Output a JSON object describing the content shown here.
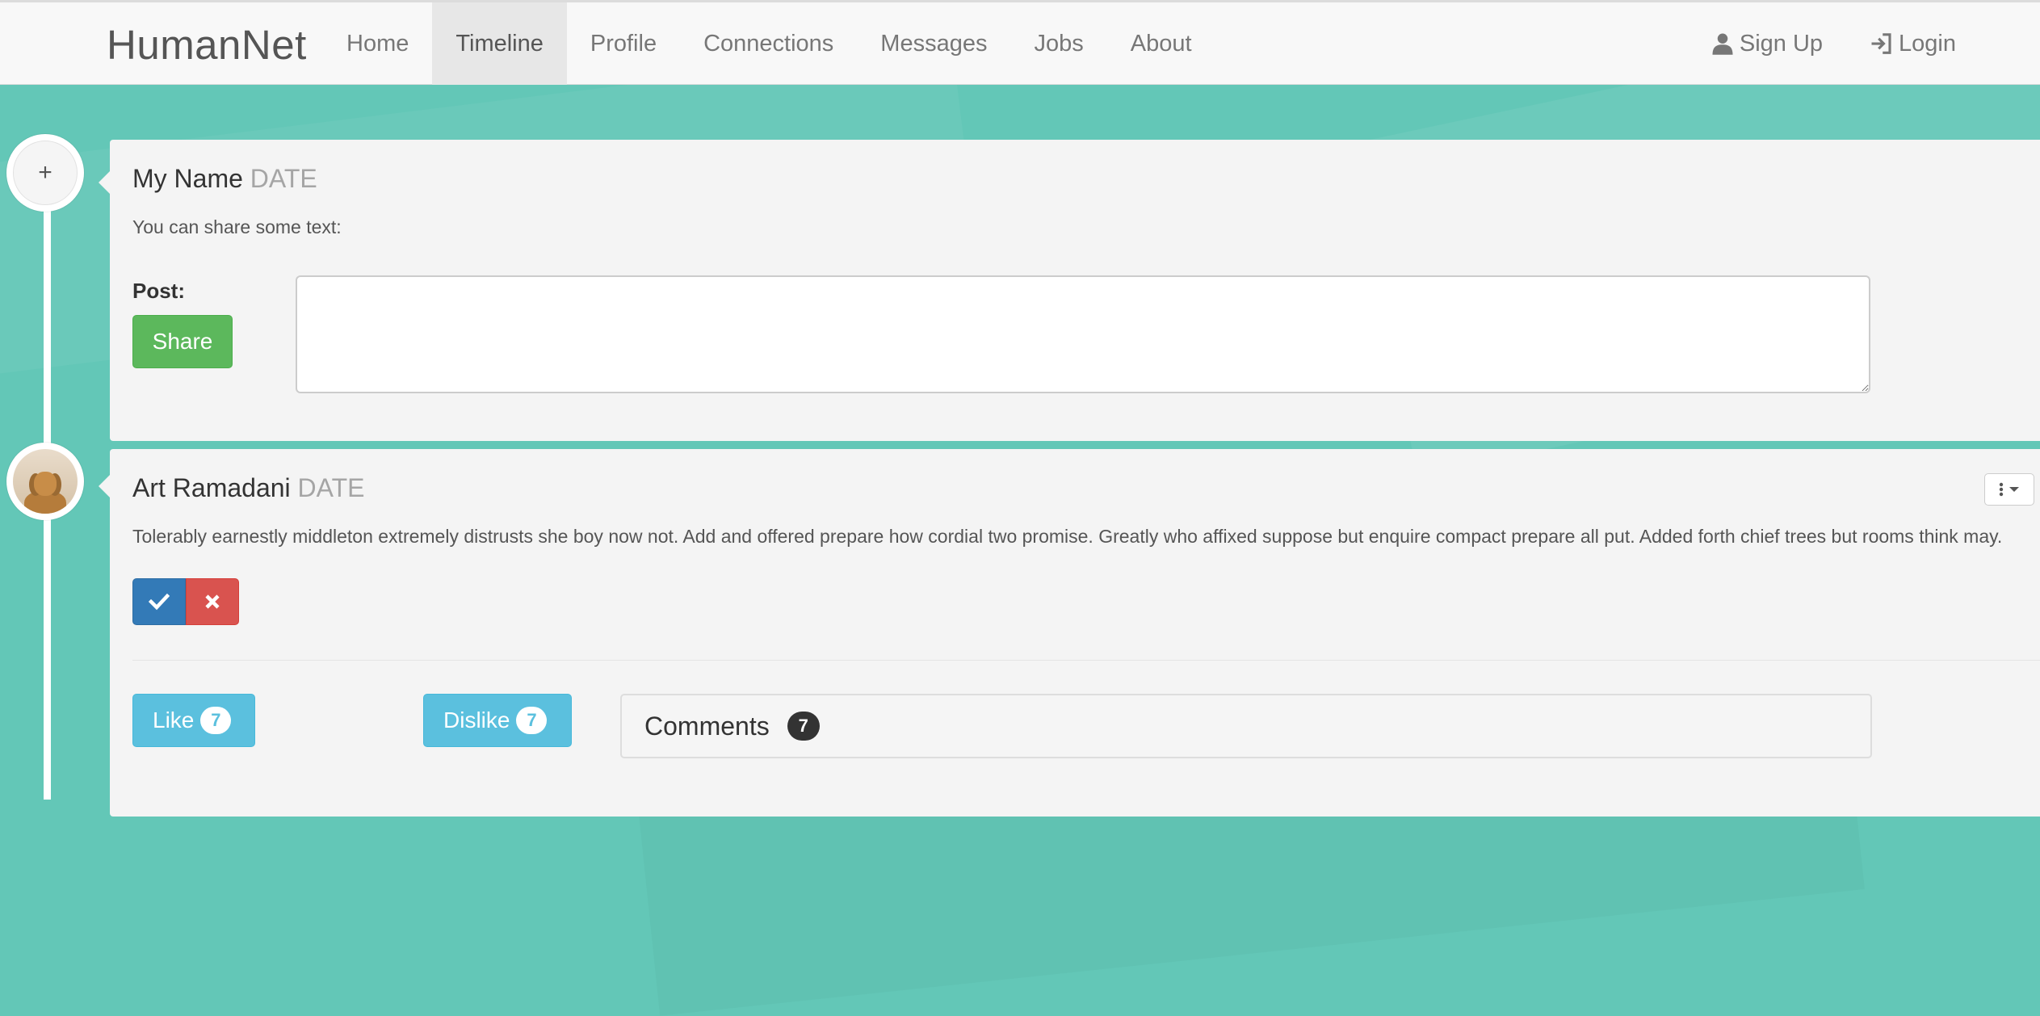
{
  "navbar": {
    "brand": "HumanNet",
    "links": [
      "Home",
      "Timeline",
      "Profile",
      "Connections",
      "Messages",
      "Jobs",
      "About"
    ],
    "active": "Timeline",
    "right": {
      "signup_label": "Sign Up",
      "login_label": "Login",
      "signup_icon": "user-icon",
      "login_icon": "login-icon"
    }
  },
  "composer": {
    "badge_icon": "plus-icon",
    "badge_symbol": "+",
    "name": "My Name",
    "date": "DATE",
    "subtitle": "You can share some text:",
    "post_label": "Post:",
    "share_label": "Share",
    "textarea_value": ""
  },
  "post": {
    "author": "Art Ramadani",
    "date": "DATE",
    "body": "Tolerably earnestly middleton extremely distrusts she boy now not. Add and offered prepare how cordial two promise. Greatly who affixed suppose but enquire compact prepare all put. Added forth chief trees but rooms think may.",
    "approve_icon": "check-icon",
    "reject_icon": "close-icon",
    "like_label": "Like",
    "like_count": "7",
    "dislike_label": "Dislike",
    "dislike_count": "7",
    "comments_label": "Comments",
    "comments_count": "7"
  },
  "colors": {
    "background": "#63c7b7",
    "share": "#5cb85c",
    "primary": "#337ab7",
    "danger": "#d9534f",
    "info": "#5bc0de"
  }
}
